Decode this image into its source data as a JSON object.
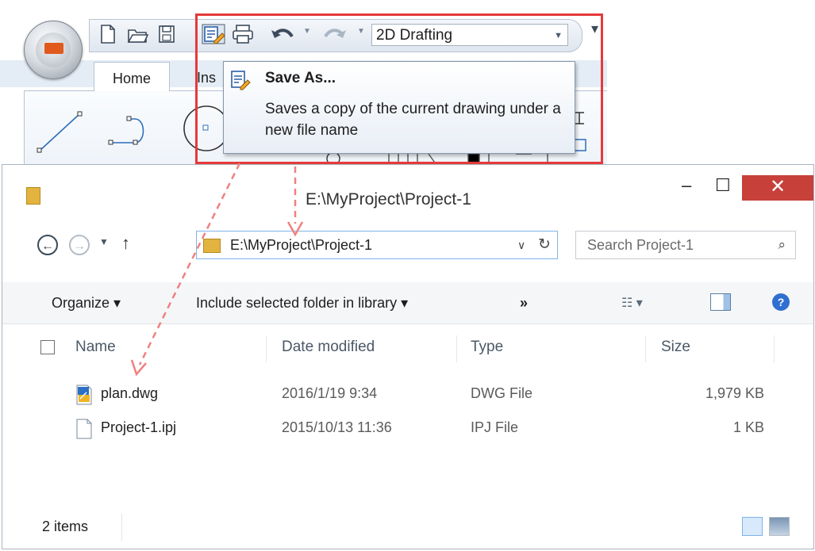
{
  "cad": {
    "workspace": "2D Drafting",
    "tabs": {
      "home": "Home",
      "insert_partial": "Ins"
    },
    "tooltip": {
      "title": "Save As...",
      "description": "Saves a copy of the current drawing under a new file name"
    }
  },
  "explorer": {
    "title": "E:\\MyProject\\Project-1",
    "window_buttons": {
      "minimize": "–",
      "maximize": "☐",
      "close": "✕"
    },
    "address": "E:\\MyProject\\Project-1",
    "search_placeholder": "Search Project-1",
    "commands": {
      "organize": "Organize ▾",
      "include": "Include selected folder in library ▾",
      "more": "»"
    },
    "columns": {
      "name": "Name",
      "date": "Date modified",
      "type": "Type",
      "size": "Size"
    },
    "files": [
      {
        "name": "plan.dwg",
        "date": "2016/1/19 9:34",
        "type": "DWG File",
        "size": "1,979 KB",
        "icon": "dwg-file-icon"
      },
      {
        "name": "Project-1.ipj",
        "date": "2015/10/13 11:36",
        "type": "IPJ File",
        "size": "1 KB",
        "icon": "generic-file-icon"
      }
    ],
    "status": "2 items"
  },
  "colors": {
    "highlight": "#e53a3a",
    "arrow": "#f08080",
    "close": "#c7403a"
  }
}
